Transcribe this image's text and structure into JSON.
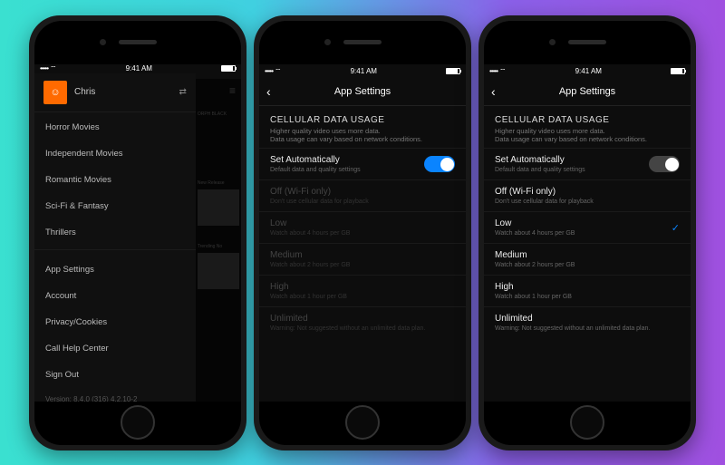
{
  "status": {
    "time": "9:41 AM",
    "carrier_dots": "•••••",
    "wifi": "wifi"
  },
  "phone1": {
    "username": "Chris",
    "avatar_emoji": "☺",
    "categories": [
      "Horror Movies",
      "Independent Movies",
      "Romantic Movies",
      "Sci-Fi & Fantasy",
      "Thrillers"
    ],
    "menu": [
      "App Settings",
      "Account",
      "Privacy/Cookies",
      "Call Help Center",
      "Sign Out"
    ],
    "version": "Version: 8.4.0 (316) 4.2.10-2",
    "background_hints": {
      "section1": "ORPH BLACK",
      "section2": "New Release",
      "section3": "Trending No"
    }
  },
  "settings": {
    "nav_title": "App Settings",
    "section_title": "CELLULAR DATA USAGE",
    "section_sub1": "Higher quality video uses more data.",
    "section_sub2": "Data usage can vary based on network conditions.",
    "autorow": {
      "label": "Set Automatically",
      "sub": "Default data and quality settings"
    },
    "options": [
      {
        "label": "Off (Wi-Fi only)",
        "sub": "Don't use cellular data for playback"
      },
      {
        "label": "Low",
        "sub": "Watch about 4 hours per GB"
      },
      {
        "label": "Medium",
        "sub": "Watch about 2 hours per GB"
      },
      {
        "label": "High",
        "sub": "Watch about 1 hour per GB"
      },
      {
        "label": "Unlimited",
        "sub": "Warning: Not suggested without an unlimited data plan."
      }
    ]
  },
  "phone2": {
    "auto_on": true
  },
  "phone3": {
    "auto_on": false,
    "selected_index": 1
  }
}
